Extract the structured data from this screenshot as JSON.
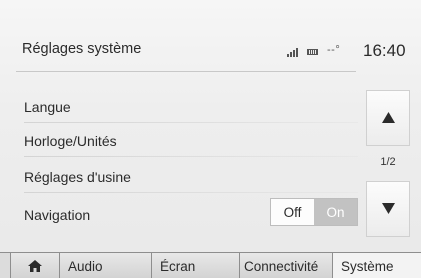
{
  "header": {
    "title": "Réglages système",
    "status_text": "--°",
    "clock": "16:40"
  },
  "list": {
    "items": [
      {
        "label": "Langue"
      },
      {
        "label": "Horloge/Unités"
      },
      {
        "label": "Réglages d'usine"
      },
      {
        "label": "Navigation"
      }
    ],
    "navigation_toggle": {
      "off_label": "Off",
      "on_label": "On",
      "selected": "off"
    }
  },
  "scroll": {
    "page_indicator": "1/2",
    "up_icon": "triangle-up-icon",
    "down_icon": "triangle-down-icon"
  },
  "tabs": [
    {
      "icon": "home-icon",
      "label": ""
    },
    {
      "label": "Audio"
    },
    {
      "label": "Écran"
    },
    {
      "label": "Connectivité"
    },
    {
      "label": "Système",
      "active": true
    }
  ],
  "colors": {
    "background": "#eeeeee",
    "toggle_on": "#c2c2c2",
    "text": "#2b2b2b"
  }
}
